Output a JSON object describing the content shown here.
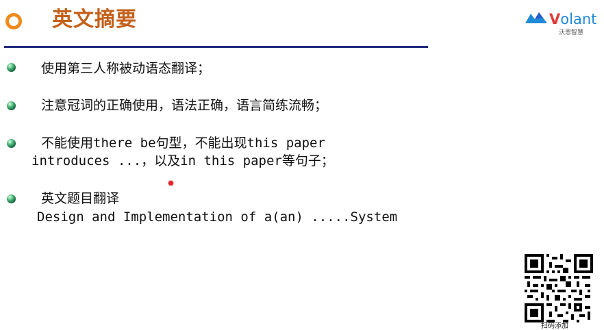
{
  "slide": {
    "title": "英文摘要",
    "accent_color": "#c4601a",
    "rule_color": "#1f2b80"
  },
  "logo": {
    "brand_prefix": "V",
    "brand_rest": "olant",
    "subtitle": "沃恩智慧"
  },
  "bullets": [
    {
      "lines": [
        "使用第三人称被动语态翻译；"
      ]
    },
    {
      "lines": [
        "注意冠词的正确使用，语法正确，语言简练流畅；"
      ]
    },
    {
      "lines": [
        "不能使用there be句型，不能出现this paper",
        "introduces ...，以及in this paper等句子；"
      ]
    },
    {
      "lines": [
        "英文题目翻译",
        "Design and Implementation of a(an) .....System"
      ]
    }
  ],
  "qr": {
    "caption": "扫码添加"
  }
}
